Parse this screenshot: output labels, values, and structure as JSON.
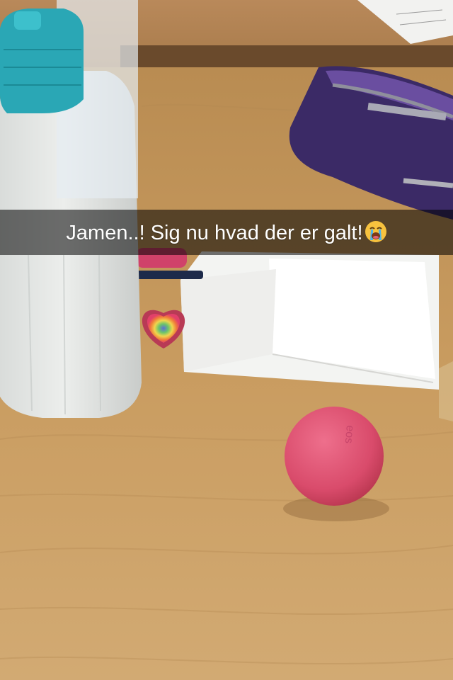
{
  "snap": {
    "caption": "Jamen..! Sig nu hvad der er galt!",
    "caption_emoji": "loudly-crying-face-emoji"
  },
  "objects": {
    "lip_balm_brand": "eos",
    "bottle_cap_color": "#2aa7b5",
    "lip_balm_color": "#e0506f",
    "pencil_case_color": "#3b2a66",
    "desk_color": "#c79a5c"
  }
}
